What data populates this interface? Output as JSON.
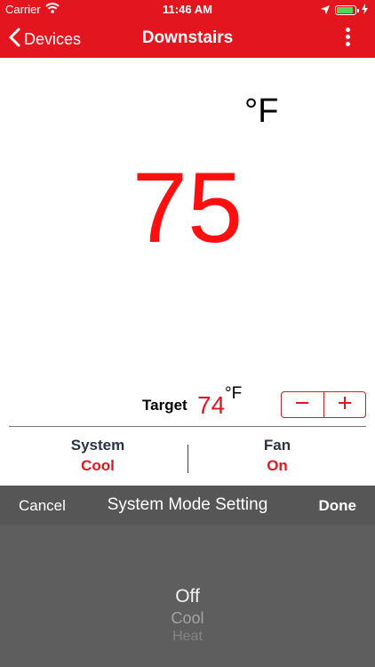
{
  "status_bar": {
    "carrier": "Carrier",
    "time": "11:46 AM",
    "battery_level": 0.9,
    "icons": [
      "wifi-icon",
      "location-arrow-icon",
      "battery-icon",
      "charging-bolt-icon"
    ]
  },
  "nav": {
    "back_label": "Devices",
    "title": "Downstairs",
    "back_icon": "chevron-left-icon",
    "menu_icon": "more-vertical-icon"
  },
  "current": {
    "temperature": "75",
    "unit": "°F"
  },
  "target": {
    "label": "Target",
    "value": "74",
    "unit": "°F",
    "decrement_icon": "minus-icon",
    "increment_icon": "plus-icon"
  },
  "modes": {
    "system": {
      "title": "System",
      "value": "Cool"
    },
    "fan": {
      "title": "Fan",
      "value": "On"
    }
  },
  "picker": {
    "cancel_label": "Cancel",
    "title": "System Mode Setting",
    "done_label": "Done",
    "options": [
      "Off",
      "Cool",
      "Heat"
    ],
    "selected": "Off"
  },
  "colors": {
    "brand_red": "#e3151f",
    "temperature_red": "#ff1010",
    "picker_bar": "#565656",
    "picker_body": "#5e5e5e",
    "label_navy": "#2b3446"
  }
}
